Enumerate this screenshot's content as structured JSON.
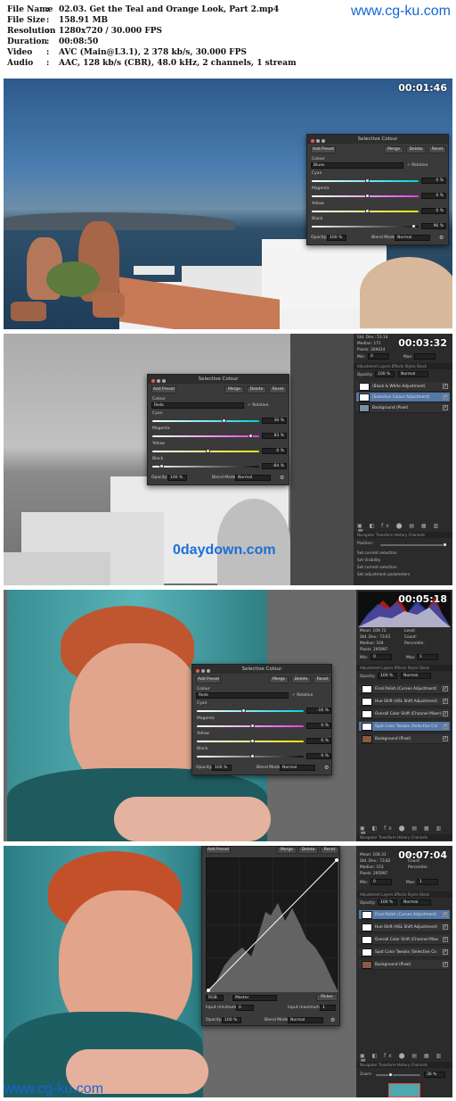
{
  "info": {
    "rows": [
      {
        "key": "File Name",
        "value": "02.03. Get the Teal and Orange Look, Part 2.mp4"
      },
      {
        "key": "File Size",
        "value": "158.91 MB"
      },
      {
        "key": "Resolution",
        "value": "1280x720 / 30.000 FPS"
      },
      {
        "key": "Duration",
        "value": "00:08:50"
      },
      {
        "key": "Video",
        "value": "AVC (Main@L3.1), 2 378 kb/s, 30.000 FPS"
      },
      {
        "key": "Audio",
        "value": "AAC, 128 kb/s (CBR), 48.0 kHz, 2 channels, 1 stream"
      }
    ],
    "sep": ":"
  },
  "watermark": {
    "top": "www.cg-ku.com",
    "bottom": "www.cg-ku.com",
    "middle": "0daydown.com"
  },
  "frames": [
    {
      "timecode": "00:01:46"
    },
    {
      "timecode": "00:03:32"
    },
    {
      "timecode": "00:05:18"
    },
    {
      "timecode": "00:07:04"
    }
  ],
  "dialog": {
    "title": "Selective Colour",
    "add_preset": "Add Preset",
    "merge": "Merge",
    "delete": "Delete",
    "reset": "Reset",
    "colour_label": "Colour",
    "relative": "Relative",
    "cyan": "Cyan",
    "magenta": "Magenta",
    "yellow": "Yellow",
    "black": "Black",
    "opacity_label": "Opacity:",
    "opacity": "100 %",
    "blend_label": "Blend Mode:",
    "blend": "Normal"
  },
  "d1": {
    "colour": "Blues",
    "cyan": "0 %",
    "magenta": "0 %",
    "yellow": "0 %",
    "black": "96 %"
  },
  "d2": {
    "colour": "Reds",
    "cyan": "30 %",
    "magenta": "83 %",
    "yellow": "0 %",
    "black": "-84 %"
  },
  "d3": {
    "colour": "Reds",
    "cyan": "-16 %",
    "magenta": "0 %",
    "yellow": "0 %",
    "black": "0 %"
  },
  "curves": {
    "add_preset": "Add Preset",
    "merge": "Merge",
    "delete": "Delete",
    "reset": "Reset",
    "channel": "RGB",
    "mode": "Master",
    "picker": "Picker",
    "input_min": "Input minimum:",
    "input_min_val": "0",
    "input_max": "Input maximum:",
    "input_max_val": "1",
    "opacity_label": "Opacity:",
    "opacity": "100 %",
    "blend_label": "Blend Mode:",
    "blend": "Normal"
  },
  "stats2": {
    "std": "Std. Dev.: 53.14",
    "median": "Median: 171",
    "pixels": "Pixels: 309414",
    "min": "Min:",
    "min_val": "0",
    "max": "Max:"
  },
  "stats3": {
    "mean": "Mean: 109.72",
    "std": "Std. Dev.: 73.61",
    "median": "Median: 104",
    "pixels": "Pixels: 295997",
    "level": "Level:",
    "count": "Count:",
    "percentile": "Percentile:",
    "min": "Min:",
    "min_val": "0",
    "max": "Max:",
    "max_val": "1"
  },
  "stats4": {
    "mean": "Mean: 108.31",
    "std": "Std. Dev.: 73.82",
    "median": "Median: 153",
    "pixels": "Pixels: 295997",
    "level": "Level:",
    "count": "Count:",
    "percentile": "Percentile:",
    "min": "Min:",
    "min_val": "0",
    "max": "Max:",
    "max_val": "1"
  },
  "tabs": {
    "layers": "Adjustment  Layers  Effects  Styles  Stock",
    "history": "Navigator  Transform  History  Channels",
    "layers4": "Adjustment  Layers  Effects  Styles  Stock"
  },
  "layers2": {
    "opacity": "100 %",
    "blend": "Normal",
    "items": [
      "(Black & White Adjustment)",
      "(Selective Colour Adjustment)",
      "Background (Pixel)"
    ]
  },
  "layers3": {
    "opacity": "100 %",
    "blend": "Normal",
    "items": [
      "Final Polish (Curves Adjustment)",
      "Hue Shift (HSL Shift Adjustment)",
      "Overall Color Shift (Channel Mixer)",
      "Spot Color Tweaks (Selective Col",
      "Background (Pixel)"
    ]
  },
  "layers4": {
    "opacity": "100 %",
    "blend": "Normal",
    "items": [
      "Final Polish (Curves Adjustment)",
      "Hue Shift (HSL Shift Adjustment)",
      "Overall Color Shift (Channel Mixe",
      "Spot Color Tweaks (Selective Co",
      "Background (Pixel)"
    ]
  },
  "history2": {
    "position": "Position:",
    "items": [
      "Set current selection",
      "Set Visibility",
      "Set current selection",
      "Set adjustment parameters"
    ]
  },
  "nav4": {
    "zoom_label": "Zoom:",
    "zoom": "36 %"
  },
  "colors": {
    "accent": "#5478a8",
    "watermark": "#1565d8"
  }
}
